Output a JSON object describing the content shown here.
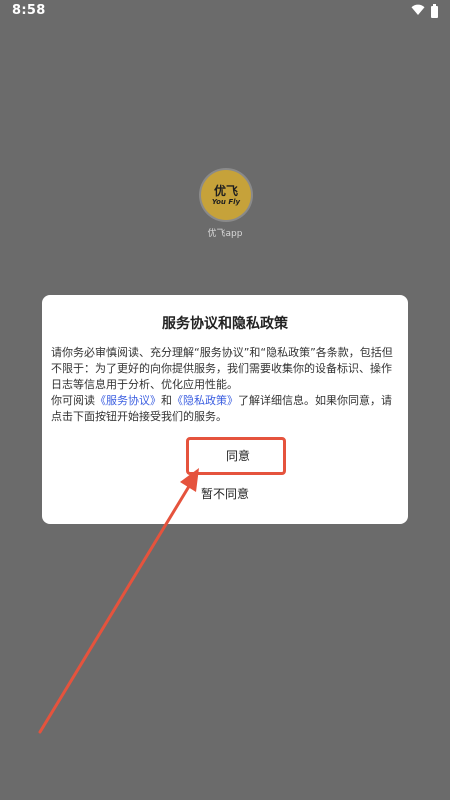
{
  "status_bar": {
    "time": "8:58",
    "icons": [
      "wifi-icon",
      "battery-icon"
    ]
  },
  "splash": {
    "logo_main": "优飞",
    "logo_sub": "You Fly",
    "app_name": "优飞app",
    "logo_color": "#c6a23a"
  },
  "dialog": {
    "title": "服务协议和隐私政策",
    "para1": "请你务必审慎阅读、充分理解“服务协议”和“隐私政策”各条款，包括但不限于：为了更好的向你提供服务，我们需要收集你的设备标识、操作日志等信息用于分析、优化应用性能。",
    "para2_prefix": "你可阅读",
    "link_service": "《服务协议》",
    "para2_and": "和",
    "link_privacy": "《隐私政策》",
    "para2_suffix": "了解详细信息。如果你同意，请点击下面按钮开始接受我们的服务。",
    "agree_label": "同意",
    "decline_label": "暂不同意",
    "link_color": "#3b5ee0"
  },
  "annotation": {
    "color": "#e5533d"
  }
}
